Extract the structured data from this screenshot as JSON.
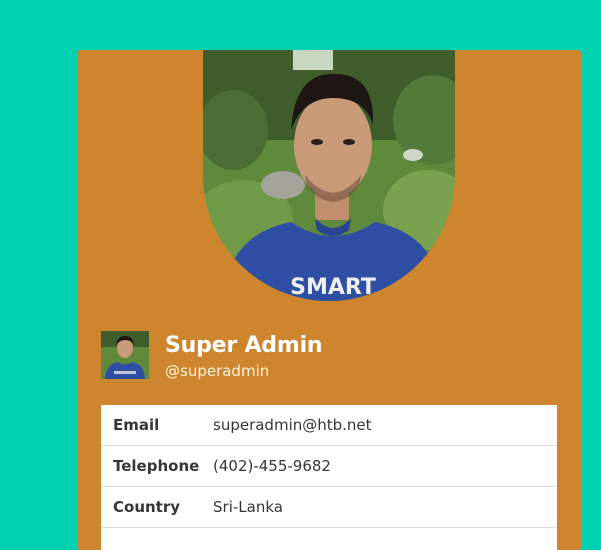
{
  "colors": {
    "page_background": "#00d1b2",
    "card_background": "#cd852e",
    "table_background": "#ffffff"
  },
  "profile": {
    "display_name": "Super Admin",
    "username": "@superadmin",
    "photo_shirt_text": "SMART"
  },
  "details": [
    {
      "label": "Email",
      "value": "superadmin@htb.net"
    },
    {
      "label": "Telephone",
      "value": "(402)-455-9682"
    },
    {
      "label": "Country",
      "value": "Sri-Lanka"
    }
  ]
}
